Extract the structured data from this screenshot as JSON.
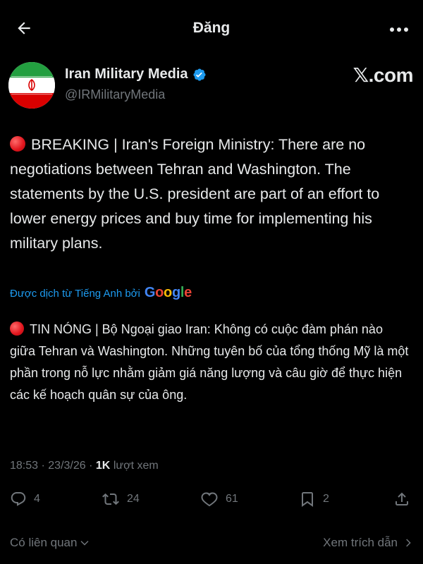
{
  "header": {
    "title": "Đăng",
    "back_icon": "arrow-left-icon",
    "more_icon": "more-dots-icon"
  },
  "author": {
    "name": "Iran Military Media",
    "handle": "@IRMilitaryMedia",
    "verified": true,
    "site_label": "𝕏.com",
    "avatar": "iran-flag-avatar"
  },
  "tweet": {
    "text": "BREAKING | Iran's Foreign Ministry: There are no negotiations between Tehran and Washington. The statements by the U.S. president are part of an effort to lower energy prices and buy time for implementing his military plans.",
    "marker_icon": "red-circle-icon"
  },
  "translation": {
    "label": "Được dịch từ Tiếng Anh bởi",
    "provider": "Google",
    "text": "TIN NÓNG | Bộ Ngoại giao Iran: Không có cuộc đàm phán nào giữa Tehran và Washington. Những tuyên bố của tổng thống Mỹ là một phần trong nỗ lực nhằm giảm giá năng lượng và câu giờ để thực hiện các kế hoạch quân sự của ông."
  },
  "meta": {
    "time": "18:53",
    "date": "23/3/26",
    "views": "1K",
    "views_label": "lượt xem"
  },
  "actions": {
    "replies": "4",
    "reposts": "24",
    "likes": "61",
    "bookmarks": "2"
  },
  "footer": {
    "related_label": "Có liên quan",
    "quotes_label": "Xem trích dẫn"
  },
  "colors": {
    "background": "#000000",
    "text": "#e7e9ea",
    "secondary": "#71767b",
    "link": "#1d9bf0",
    "verified": "#1d9bf0",
    "breaking_dot": "#e0141c"
  }
}
